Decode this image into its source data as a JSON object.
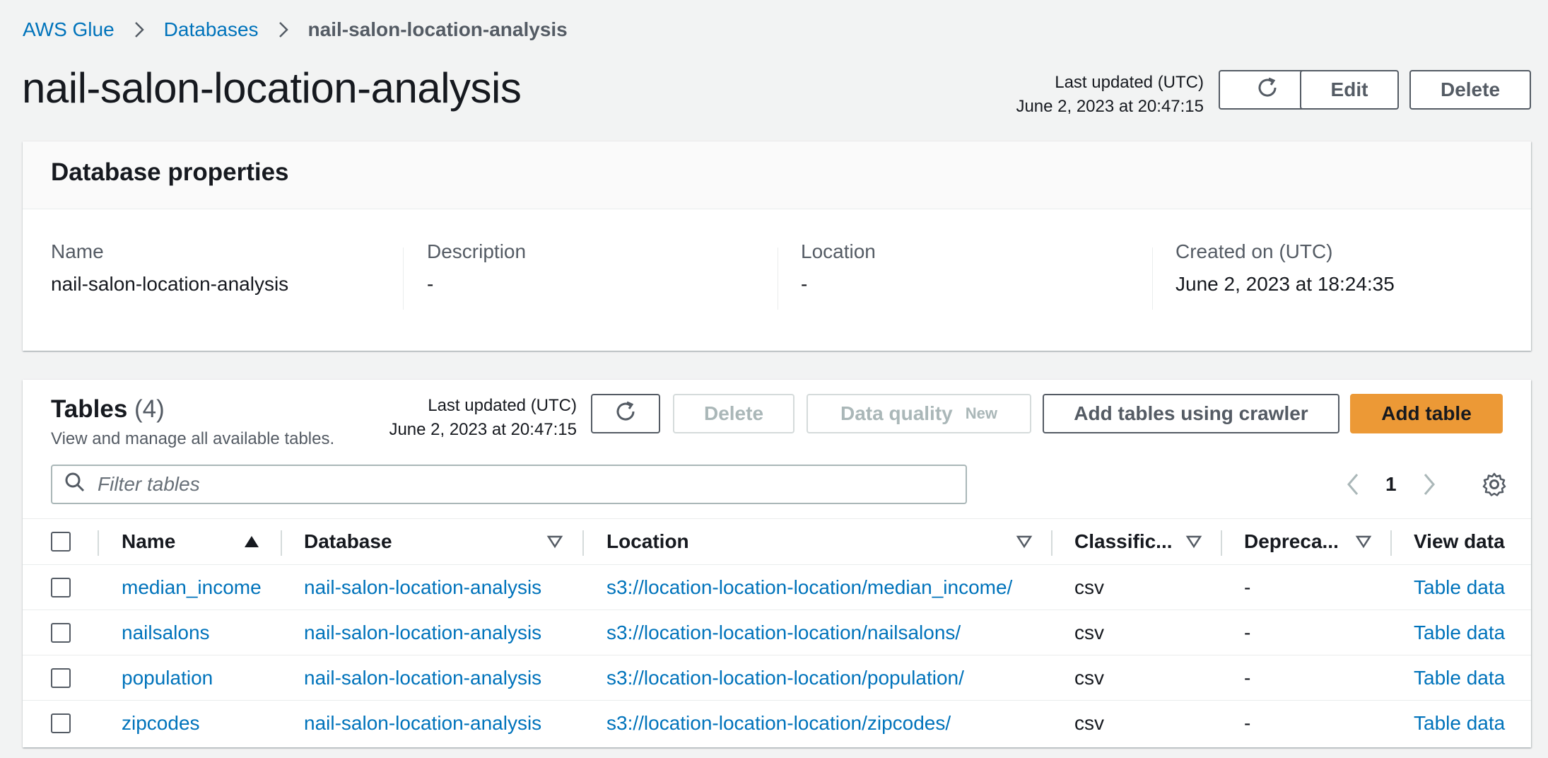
{
  "breadcrumb": {
    "items": [
      "AWS Glue",
      "Databases"
    ],
    "current": "nail-salon-location-analysis"
  },
  "header": {
    "title": "nail-salon-location-analysis",
    "last_updated_label": "Last updated (UTC)",
    "last_updated_value": "June 2, 2023 at 20:47:15",
    "edit_label": "Edit",
    "delete_label": "Delete"
  },
  "properties": {
    "title": "Database properties",
    "fields": [
      {
        "label": "Name",
        "value": "nail-salon-location-analysis"
      },
      {
        "label": "Description",
        "value": "-"
      },
      {
        "label": "Location",
        "value": "-"
      },
      {
        "label": "Created on (UTC)",
        "value": "June 2, 2023 at 18:24:35"
      }
    ]
  },
  "tables": {
    "title": "Tables",
    "count": "(4)",
    "subtitle": "View and manage all available tables.",
    "last_updated_label": "Last updated (UTC)",
    "last_updated_value": "June 2, 2023 at 20:47:15",
    "delete_label": "Delete",
    "data_quality_label": "Data quality",
    "data_quality_tag": "New",
    "crawler_label": "Add tables using crawler",
    "add_label": "Add table",
    "filter_placeholder": "Filter tables",
    "page": "1",
    "columns": [
      "Name",
      "Database",
      "Location",
      "Classific...",
      "Depreca...",
      "View data"
    ],
    "rows": [
      {
        "name": "median_income",
        "database": "nail-salon-location-analysis",
        "location": "s3://location-location-location/median_income/",
        "classification": "csv",
        "deprecated": "-",
        "view": "Table data"
      },
      {
        "name": "nailsalons",
        "database": "nail-salon-location-analysis",
        "location": "s3://location-location-location/nailsalons/",
        "classification": "csv",
        "deprecated": "-",
        "view": "Table data"
      },
      {
        "name": "population",
        "database": "nail-salon-location-analysis",
        "location": "s3://location-location-location/population/",
        "classification": "csv",
        "deprecated": "-",
        "view": "Table data"
      },
      {
        "name": "zipcodes",
        "database": "nail-salon-location-analysis",
        "location": "s3://location-location-location/zipcodes/",
        "classification": "csv",
        "deprecated": "-",
        "view": "Table data"
      }
    ]
  },
  "colors": {
    "link": "#0073bb",
    "primary_button": "#ec9936",
    "background": "#f2f3f3"
  }
}
